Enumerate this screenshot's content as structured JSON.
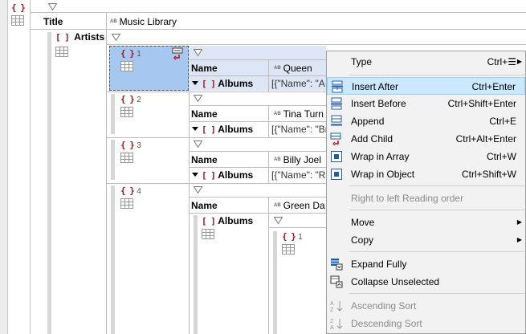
{
  "root": {
    "brace": "{ }"
  },
  "title_row": {
    "key": "Title",
    "value": "Music Library"
  },
  "artists": {
    "key": "Artists",
    "bracket": "[ ]",
    "items": [
      {
        "index": "1",
        "name_key": "Name",
        "name": "Queen",
        "albums_key": "Albums",
        "albums_value": "[{\"Name\": \"A N"
      },
      {
        "index": "2",
        "name_key": "Name",
        "name": "Tina Turn",
        "albums_key": "Albums",
        "albums_value": "[{\"Name\": \"Bre"
      },
      {
        "index": "3",
        "name_key": "Name",
        "name": "Billy Joel",
        "albums_key": "Albums",
        "albums_value": "[{\"Name\": \"Riv"
      },
      {
        "index": "4",
        "name_key": "Name",
        "name": "Green Da",
        "albums_key": "Albums",
        "albums_sub_index": "1"
      }
    ]
  },
  "type_badge": "AB",
  "brace_label": "{ }",
  "bracket_label": "[ ]",
  "menu": {
    "items": [
      {
        "label": "Type",
        "shortcut": "Ctrl+☰"
      },
      {
        "label": "Insert After",
        "shortcut": "Ctrl+Enter"
      },
      {
        "label": "Insert Before",
        "shortcut": "Ctrl+Shift+Enter"
      },
      {
        "label": "Append",
        "shortcut": "Ctrl+E"
      },
      {
        "label": "Add Child",
        "shortcut": "Ctrl+Alt+Enter"
      },
      {
        "label": "Wrap in Array",
        "shortcut": "Ctrl+W"
      },
      {
        "label": "Wrap in Object",
        "shortcut": "Ctrl+Shift+W"
      },
      {
        "label": "Right to left Reading order",
        "shortcut": ""
      },
      {
        "label": "Move",
        "shortcut": ""
      },
      {
        "label": "Copy",
        "shortcut": ""
      },
      {
        "label": "Expand Fully",
        "shortcut": ""
      },
      {
        "label": "Collapse Unselected",
        "shortcut": ""
      },
      {
        "label": "Ascending Sort",
        "shortcut": ""
      },
      {
        "label": "Descending Sort",
        "shortcut": ""
      }
    ]
  },
  "colors": {
    "key_brace": "#a31515",
    "selection": "#a6c8f0",
    "menu_highlight": "#cce8ff",
    "menu_background": "#f2f2f2"
  }
}
